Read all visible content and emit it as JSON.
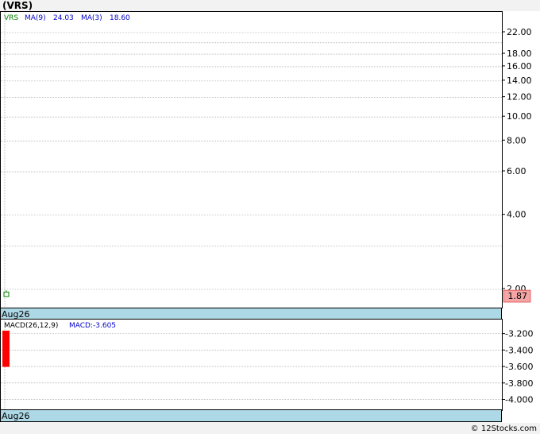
{
  "title": "(VRS)",
  "price_legend": {
    "ticker": "VRS",
    "ma9_label": "MA(9)",
    "ma9_value": "24.03",
    "ma3_label": "MA(3)",
    "ma3_value": "18.60"
  },
  "macd_legend": {
    "label": "MACD(26,12,9)",
    "value_text": "MACD:-3.605"
  },
  "date_label_top": "Aug26",
  "date_label_bottom": "Aug26",
  "last_price_badge": "1.87",
  "copyright": "© 12Stocks.com",
  "colors": {
    "ticker": "#008000",
    "legend_blue": "#0000cc",
    "grid": "#999999",
    "candle": "#008000",
    "macd_bar": "#ff0000",
    "badge_bg": "#f4a6a6",
    "date_bar": "#add8e6"
  },
  "chart_data": [
    {
      "type": "line",
      "scale": "log",
      "yticks": [
        "22.00",
        "18.00",
        "16.00",
        "14.00",
        "12.00",
        "10.00",
        "8.00",
        "6.00",
        "4.00",
        "2.00"
      ],
      "ytick_values": [
        22,
        18,
        16,
        14,
        12,
        10,
        8,
        6,
        4,
        2
      ],
      "candles": [
        {
          "date": "Aug26",
          "open": 1.87,
          "close": 1.95,
          "high": 1.98,
          "low": 1.87
        }
      ],
      "last_price": 1.87
    },
    {
      "type": "bar",
      "yticks": [
        "-3.200",
        "-3.400",
        "-3.600",
        "-3.800",
        "-4.000"
      ],
      "ytick_values": [
        -3.2,
        -3.4,
        -3.6,
        -3.8,
        -4.0
      ],
      "ylim": [
        -4.13,
        -3.03
      ],
      "values": [
        -3.605
      ]
    }
  ]
}
